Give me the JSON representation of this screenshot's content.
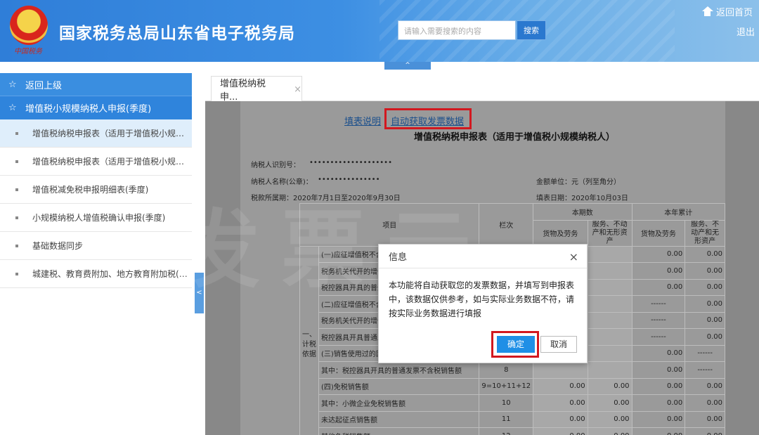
{
  "header": {
    "emblem_script": "中国税务",
    "site_title": "国家税务总局山东省电子税务局",
    "search_placeholder": "请输入需要搜索的内容",
    "search_button": "搜索",
    "home_link": "返回首页",
    "logout_link": "退出",
    "collapse_arrow": "^"
  },
  "sidebar": {
    "back": "返回上级",
    "group": "增值税小规模纳税人申报(季度)",
    "items": [
      {
        "label": "增值税纳税申报表（适用于增值税小规模纳税人）"
      },
      {
        "label": "增值税纳税申报表（适用于增值税小规模纳税人）附列资料"
      },
      {
        "label": "增值税减免税申报明细表(季度)"
      },
      {
        "label": "小规模纳税人增值税确认申报(季度)"
      },
      {
        "label": "基础数据同步"
      },
      {
        "label": "城建税、教育费附加、地方教育附加税(费)申报"
      }
    ],
    "toggle": "<"
  },
  "tabs": [
    {
      "label": "增值税纳税申...",
      "close": "×"
    }
  ],
  "form": {
    "help_link": "填表说明",
    "auto_link": "自动获取发票数据",
    "title": "增值税纳税申报表（适用于增值税小规模纳税人）",
    "taxpayer_id_label": "纳税人识别号：",
    "taxpayer_id": "••••••••••••••••••••",
    "taxpayer_name_label": "纳税人名称(公章)：",
    "taxpayer_name": "•••••••••••••••",
    "unit": "金额单位：元（列至角分）",
    "period": "税款所属期：2020年7月1日至2020年9月30日",
    "fill_date": "填表日期：2020年10月03日",
    "header_item": "项目",
    "header_line": "栏次",
    "header_current": "本期数",
    "header_ytd": "本年累计",
    "header_goods": "货物及劳务",
    "header_services": "服务、不动产和无形资产",
    "side_label": "一、计税依据",
    "rows": [
      {
        "item": "(一)应征增值税不含税销售额（3%征收率）",
        "line": "",
        "v1": "",
        "v2": "",
        "v3": "0.00",
        "v4": "0.00"
      },
      {
        "item": "税务机关代开的增值税专用发票不含税销售额",
        "line": "",
        "v1": "",
        "v2": "",
        "v3": "0.00",
        "v4": "0.00"
      },
      {
        "item": "税控器具开具的普通发票不含税销售额",
        "line": "",
        "v1": "",
        "v2": "",
        "v3": "0.00",
        "v4": "0.00"
      },
      {
        "item": "(二)应征增值税不含税销售额（5%征收率）",
        "line": "",
        "v1": "",
        "v2": "",
        "v3": "------",
        "v4": "0.00"
      },
      {
        "item": "税务机关代开的增值税专用发票不含税销售额",
        "line": "",
        "v1": "",
        "v2": "",
        "v3": "------",
        "v4": "0.00"
      },
      {
        "item": "税控器具开具普通发票不含税销售额",
        "line": "",
        "v1": "",
        "v2": "",
        "v3": "------",
        "v4": "0.00"
      },
      {
        "item": "(三)销售使用过的固定资产不含税销售额",
        "line": "",
        "v1": "",
        "v2": "",
        "v3": "0.00",
        "v4": "------"
      },
      {
        "item": "其中：税控器具开具的普通发票不含税销售额",
        "line": "8",
        "v1": "",
        "v2": "",
        "v3": "0.00",
        "v4": "------"
      },
      {
        "item": "(四)免税销售额",
        "line": "9=10+11+12",
        "v1": "0.00",
        "v2": "0.00",
        "v3": "0.00",
        "v4": "0.00"
      },
      {
        "item": "其中：小微企业免税销售额",
        "line": "10",
        "v1": "0.00",
        "v2": "0.00",
        "v3": "0.00",
        "v4": "0.00"
      },
      {
        "item": "未达起征点销售额",
        "line": "11",
        "v1": "0.00",
        "v2": "0.00",
        "v3": "0.00",
        "v4": "0.00"
      },
      {
        "item": "其他免税销售额",
        "line": "12",
        "v1": "0.00",
        "v2": "0.00",
        "v3": "0.00",
        "v4": "0.00"
      }
    ]
  },
  "dialog": {
    "title": "信息",
    "close": "×",
    "message": "本功能将自动获取您的发票数据，并填写到申报表中，该数据仅供参考，如与实际业务数据不符，请按实际业务数据进行填报",
    "ok": "确定",
    "cancel": "取消"
  },
  "watermark": "发票云"
}
